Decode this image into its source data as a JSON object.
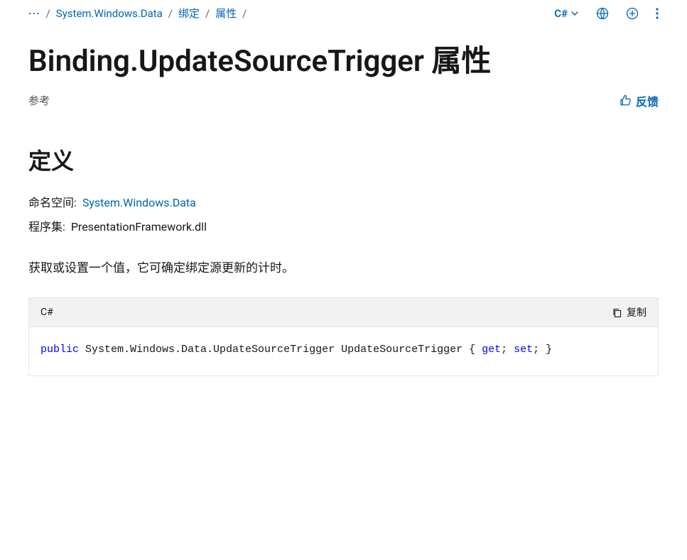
{
  "breadcrumb": {
    "ellipsis": "···",
    "items": [
      "System.Windows.Data",
      "绑定",
      "属性"
    ]
  },
  "topbar": {
    "language": "C#"
  },
  "title": "Binding.UpdateSourceTrigger 属性",
  "reference_label": "参考",
  "feedback_label": "反馈",
  "section_definition": "定义",
  "namespace_label": "命名空间:",
  "namespace_value": "System.Windows.Data",
  "assembly_label": "程序集:",
  "assembly_value": "PresentationFramework.dll",
  "description": "获取或设置一个值，它可确定绑定源更新的计时。",
  "code": {
    "lang_label": "C#",
    "copy_label": "复制",
    "kw_public": "public",
    "type_text": " System.Windows.Data.UpdateSourceTrigger UpdateSourceTrigger { ",
    "kw_get": "get",
    "sep1": "; ",
    "kw_set": "set",
    "sep2": "; }"
  }
}
